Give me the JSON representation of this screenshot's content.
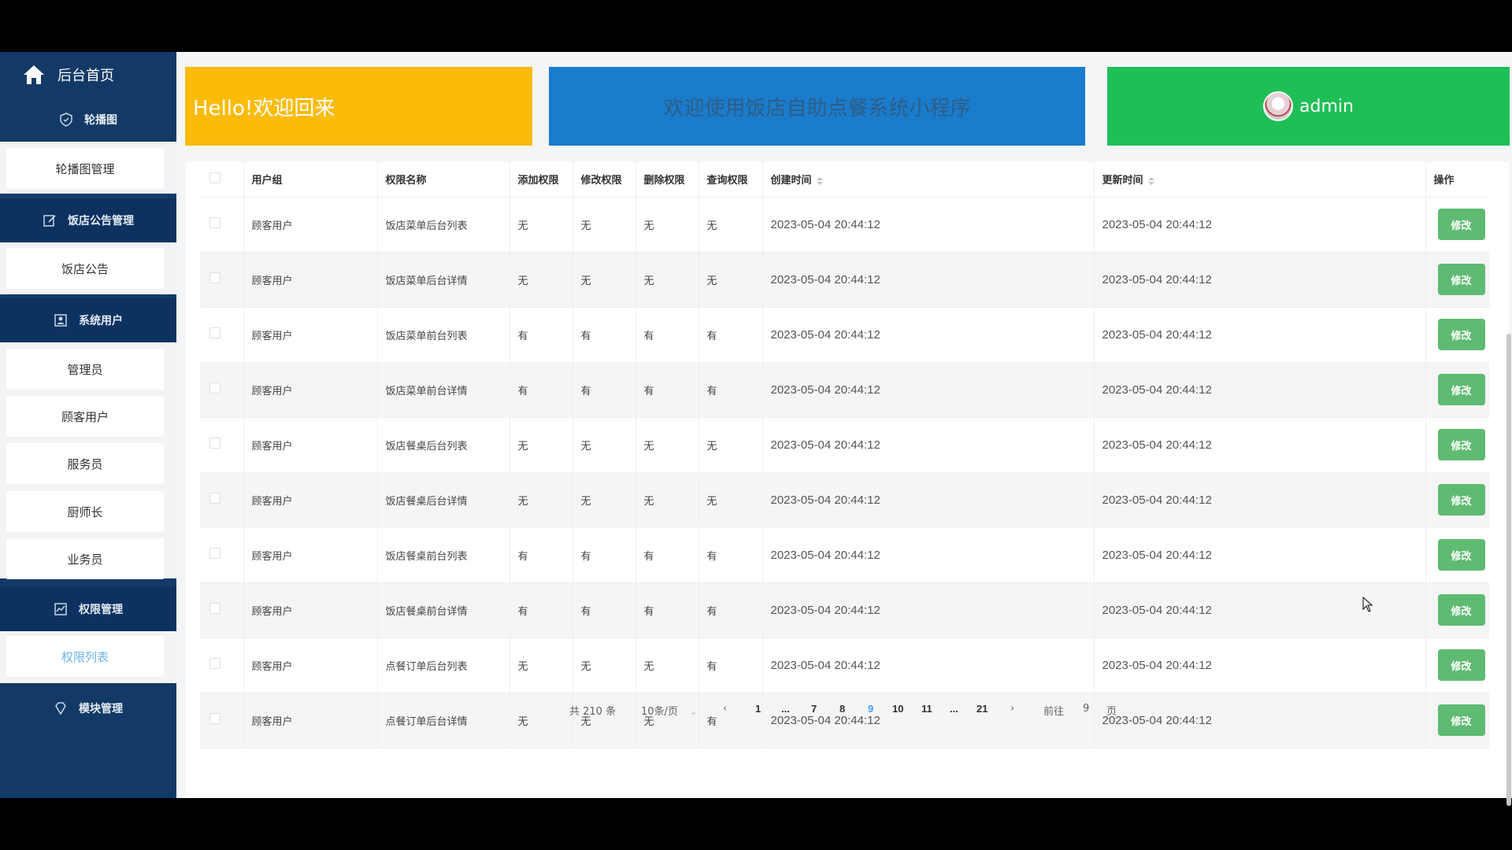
{
  "sidebar": {
    "home": "后台首页",
    "groups": [
      {
        "label": "轮播图",
        "icon": "shield-icon"
      },
      {
        "label": "饭店公告管理",
        "icon": "edit-icon"
      },
      {
        "label": "系统用户",
        "icon": "user-box-icon"
      },
      {
        "label": "权限管理",
        "icon": "chart-icon"
      },
      {
        "label": "模块管理",
        "icon": "diamond-icon"
      }
    ],
    "items": [
      "轮播图管理",
      "饭店公告",
      "管理员",
      "顾客用户",
      "服务员",
      "厨师长",
      "业务员",
      "权限列表"
    ]
  },
  "header": {
    "hello": "Hello!欢迎回来",
    "title": "欢迎使用饭店自助点餐系统小程序",
    "user": "admin"
  },
  "table": {
    "columns": [
      "用户组",
      "权限名称",
      "添加权限",
      "修改权限",
      "删除权限",
      "查询权限",
      "创建时间",
      "更新时间",
      "操作"
    ],
    "edit_label": "修改",
    "rows": [
      [
        "顾客用户",
        "饭店菜单后台列表",
        "无",
        "无",
        "无",
        "无",
        "2023-05-04 20:44:12",
        "2023-05-04 20:44:12"
      ],
      [
        "顾客用户",
        "饭店菜单后台详情",
        "无",
        "无",
        "无",
        "无",
        "2023-05-04 20:44:12",
        "2023-05-04 20:44:12"
      ],
      [
        "顾客用户",
        "饭店菜单前台列表",
        "有",
        "有",
        "有",
        "有",
        "2023-05-04 20:44:12",
        "2023-05-04 20:44:12"
      ],
      [
        "顾客用户",
        "饭店菜单前台详情",
        "有",
        "有",
        "有",
        "有",
        "2023-05-04 20:44:12",
        "2023-05-04 20:44:12"
      ],
      [
        "顾客用户",
        "饭店餐桌后台列表",
        "无",
        "无",
        "无",
        "无",
        "2023-05-04 20:44:12",
        "2023-05-04 20:44:12"
      ],
      [
        "顾客用户",
        "饭店餐桌后台详情",
        "无",
        "无",
        "无",
        "无",
        "2023-05-04 20:44:12",
        "2023-05-04 20:44:12"
      ],
      [
        "顾客用户",
        "饭店餐桌前台列表",
        "有",
        "有",
        "有",
        "有",
        "2023-05-04 20:44:12",
        "2023-05-04 20:44:12"
      ],
      [
        "顾客用户",
        "饭店餐桌前台详情",
        "有",
        "有",
        "有",
        "有",
        "2023-05-04 20:44:12",
        "2023-05-04 20:44:12"
      ],
      [
        "顾客用户",
        "点餐订单后台列表",
        "无",
        "无",
        "无",
        "有",
        "2023-05-04 20:44:12",
        "2023-05-04 20:44:12"
      ],
      [
        "顾客用户",
        "点餐订单后台详情",
        "无",
        "无",
        "无",
        "有",
        "2023-05-04 20:44:12",
        "2023-05-04 20:44:12"
      ]
    ]
  },
  "pager": {
    "total": "共 210 条",
    "size": "10条/页",
    "pages": [
      "1",
      "...",
      "7",
      "8",
      "9",
      "10",
      "11",
      "...",
      "21"
    ],
    "current": "9",
    "goto_prefix": "前往",
    "goto_value": "9",
    "goto_suffix": "页"
  }
}
